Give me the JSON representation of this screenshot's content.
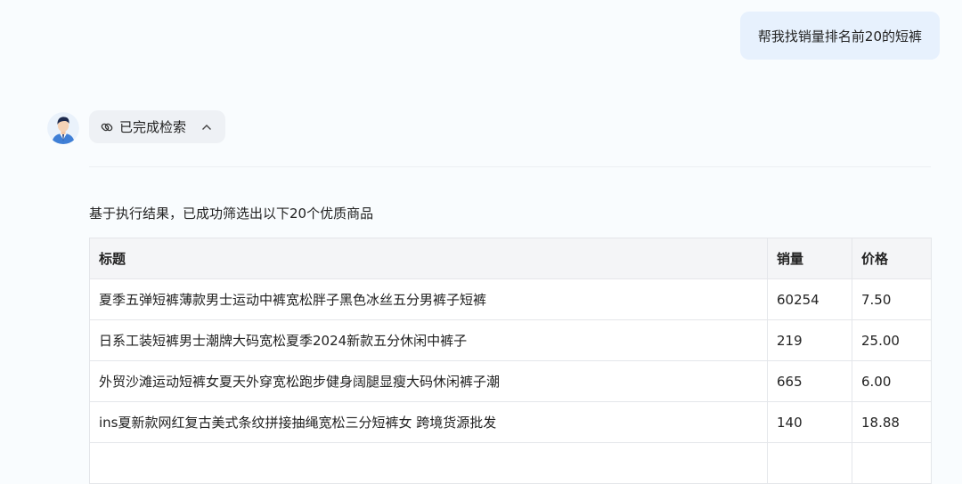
{
  "user_message": "帮我找销量排名前20的短裤",
  "status": {
    "label": "已完成检索"
  },
  "summary_text": "基于执行结果，已成功筛选出以下20个优质商品",
  "table": {
    "headers": [
      "标题",
      "销量",
      "价格"
    ],
    "rows": [
      [
        "夏季五弹短裤薄款男士运动中裤宽松胖子黑色冰丝五分男裤子短裤",
        "60254",
        "7.50"
      ],
      [
        "日系工装短裤男士潮牌大码宽松夏季2024新款五分休闲中裤子",
        "219",
        "25.00"
      ],
      [
        "外贸沙滩运动短裤女夏天外穿宽松跑步健身阔腿显瘦大码休闲裤子潮",
        "665",
        "6.00"
      ],
      [
        "ins夏新款网红复古美式条纹拼接抽绳宽松三分短裤女 跨境货源批发",
        "140",
        "18.88"
      ],
      [
        "",
        "",
        ""
      ]
    ]
  },
  "colors": {
    "user_bubble_bg": "#e7f1fd",
    "pill_bg": "#eef1f5",
    "page_bg": "#f9fcfe"
  }
}
